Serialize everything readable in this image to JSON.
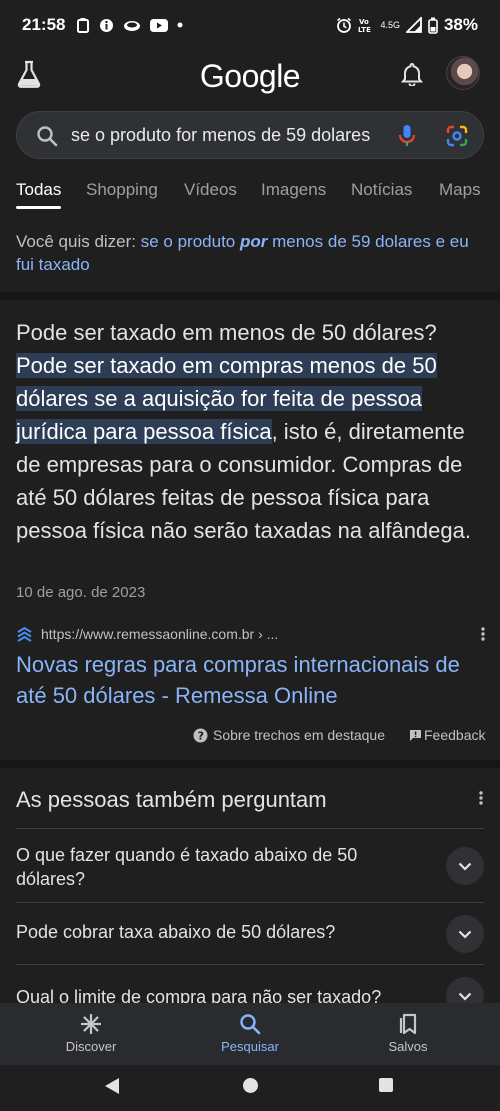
{
  "status_bar": {
    "time": "21:58",
    "network": "4.5G",
    "battery": "38%"
  },
  "header": {
    "logo": "Google"
  },
  "search": {
    "query": "se o produto for menos de 59 dolares"
  },
  "tabs": [
    {
      "label": "Todas",
      "active": true
    },
    {
      "label": "Shopping"
    },
    {
      "label": "Vídeos"
    },
    {
      "label": "Imagens"
    },
    {
      "label": "Notícias"
    },
    {
      "label": "Maps"
    }
  ],
  "did_you_mean": {
    "prefix": "Você quis dizer: ",
    "part1": "se o produto ",
    "bold": "por",
    "part2": " menos de 59 dolares e eu fui taxado"
  },
  "snippet": {
    "question": "Pode ser taxado em menos de 50 dólares?",
    "highlight": "Pode ser taxado em compras menos de 50 dólares se a aquisição for feita de pessoa jurídica para pessoa física",
    "rest": ", isto é, diretamente de empresas para o consumidor. Compras de até 50 dólares feitas de pessoa física para pessoa física não serão taxadas na alfândega.",
    "date": "10 de ago. de 2023",
    "source_url": "https://www.remessaonline.com.br › ...",
    "result_title": "Novas regras para compras internacionais de até 50 dólares - Remessa Online",
    "about_label": "Sobre trechos em destaque",
    "feedback_label": "Feedback"
  },
  "people_also_ask": {
    "title": "As pessoas também perguntam",
    "questions": [
      "O que fazer quando é taxado abaixo de 50 dólares?",
      "Pode cobrar taxa abaixo de 50 dólares?",
      "Qual o limite de compra para não ser taxado?"
    ]
  },
  "bottom_nav": [
    {
      "label": "Discover",
      "icon": "asterisk-icon"
    },
    {
      "label": "Pesquisar",
      "icon": "search-icon",
      "active": true
    },
    {
      "label": "Salvos",
      "icon": "bookmarks-icon"
    }
  ],
  "colors": {
    "background": "#1f1f1f",
    "link": "#8ab4f8",
    "highlight": "#2d3d55"
  }
}
